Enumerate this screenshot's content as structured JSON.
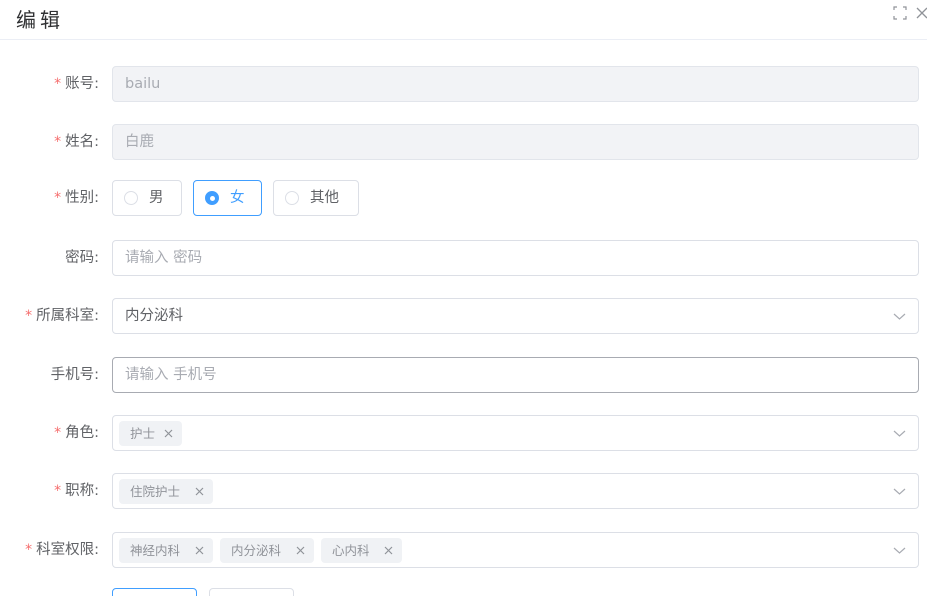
{
  "dialog": {
    "title": "编辑"
  },
  "icons": {
    "maximize": "fullscreen-icon",
    "close": "close-icon",
    "select_arrow": "chevron-down-icon",
    "tag_remove": "x-icon"
  },
  "form": {
    "account": {
      "label": "账号:",
      "required": true,
      "value": "bailu",
      "disabled": true
    },
    "name": {
      "label": "姓名:",
      "required": true,
      "value": "白鹿",
      "disabled": true
    },
    "gender": {
      "label": "性别:",
      "required": true,
      "options": [
        "男",
        "女",
        "其他"
      ],
      "selected": "女"
    },
    "password": {
      "label": "密码:",
      "required": false,
      "value": "",
      "placeholder": "请输入 密码"
    },
    "department": {
      "label": "所属科室:",
      "required": true,
      "value": "内分泌科"
    },
    "phone": {
      "label": "手机号:",
      "required": false,
      "value": "",
      "placeholder": "请输入 手机号"
    },
    "role": {
      "label": "角色:",
      "required": true,
      "tags": [
        "护士"
      ]
    },
    "title": {
      "label": "职称:",
      "required": true,
      "tags": [
        "住院护士"
      ]
    },
    "dept_permission": {
      "label": "科室权限:",
      "required": true,
      "tags": [
        "神经内科",
        "内分泌科",
        "心内科"
      ]
    }
  },
  "colors": {
    "primary": "#409eff",
    "required": "#f56c6c",
    "disabled_bg": "#f2f3f6",
    "border": "#dcdfe6"
  }
}
